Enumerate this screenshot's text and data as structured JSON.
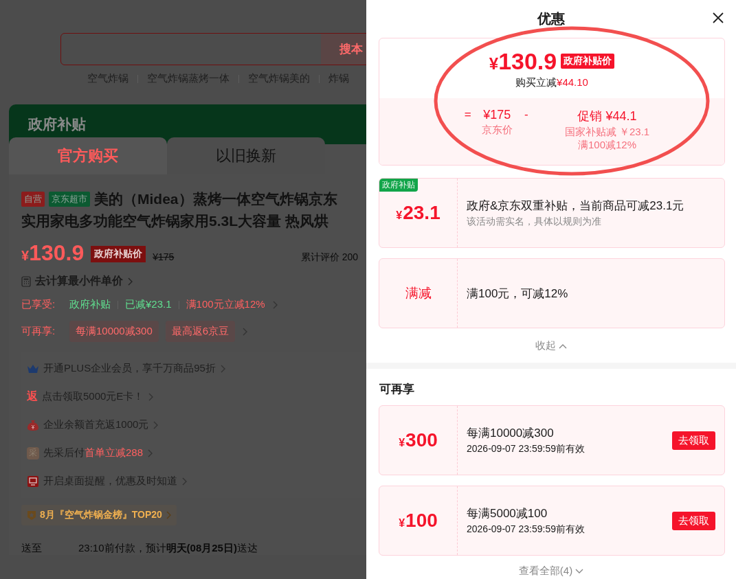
{
  "search": {
    "button": "搜本"
  },
  "suggestions": [
    "空气炸锅",
    "空气炸锅蒸烤一体",
    "空气炸锅美的",
    "炸锅"
  ],
  "subsidy_banner": {
    "title": "政府补贴"
  },
  "purchase_tabs": [
    {
      "label": "官方购买",
      "selected": true
    },
    {
      "label": "以旧换新",
      "selected": false
    }
  ],
  "product": {
    "badges": [
      {
        "label": "自营",
        "color": "#8c1c1c"
      },
      {
        "label": "京东超市",
        "color": "#0b5a31"
      }
    ],
    "title_lines": [
      "美的（Midea）蒸烤一体空气炸锅京东",
      "实用家电多功能空气炸锅家用5.3L大容量 热风烘"
    ],
    "price": {
      "currency": "¥",
      "amount": "130.9",
      "tag": "政府补贴价",
      "original": "¥175"
    },
    "reviews": "累计评价 200",
    "unit_price_link": "去计算最小件单价",
    "enjoyed": {
      "label": "已享受:",
      "items": [
        {
          "text": "政府补贴",
          "kind": "subsidy"
        },
        {
          "text": "已减¥23.1",
          "kind": "subsidy"
        },
        {
          "text": "满100元立减12%",
          "kind": "discount"
        }
      ]
    },
    "more": {
      "label": "可再享:",
      "chips": [
        "每满10000减300",
        "最高返6京豆"
      ]
    },
    "benefits": [
      {
        "kind": "crown",
        "text": "开通PLUS企业会员，享千万商品95折"
      },
      {
        "kind": "glyph",
        "glyph": "返",
        "text": "点击领取5000元E卡！"
      },
      {
        "kind": "money-bag",
        "text": "企业余额首充返1000元"
      },
      {
        "kind": "tile",
        "glyph": "采",
        "text": "先采后付",
        "highlight": "首单立减288"
      },
      {
        "kind": "monitor",
        "text": "开启桌面提醒，优惠及时知道"
      }
    ],
    "ranking": "8月『空气炸锅金榜』TOP20",
    "delivery": {
      "label": "送至",
      "text": "23:10前付款，预计**明天(08月25日)**送达"
    }
  },
  "drawer": {
    "title": "优惠",
    "summary": {
      "currency": "¥",
      "amount": "130.9",
      "tag": "政府补贴价",
      "saving_label": "购买立减",
      "saving": "¥44.10",
      "breakdown": {
        "equals": "=",
        "base": "¥175",
        "base_label": "京东价",
        "minus": "-",
        "promo_label": "促销",
        "promo": "¥44.1",
        "details": [
          "国家补贴减 ￥23.1",
          "满100减12%"
        ]
      }
    },
    "applied": [
      {
        "kind": "amount",
        "tag": "政府补贴",
        "currency": "¥",
        "amount": "23.1",
        "title": "政府&京东双重补贴，当前商品可减23.1元",
        "note": "该活动需实名，具体以规则为准"
      },
      {
        "kind": "label",
        "label": "满减",
        "title": "满100元，可减12%"
      }
    ],
    "collapse": "收起",
    "more_title": "可再享",
    "coupons": [
      {
        "currency": "¥",
        "amount": "300",
        "title": "每满10000减300",
        "validity": "2026-09-07 23:59:59前有效",
        "action": "去领取"
      },
      {
        "currency": "¥",
        "amount": "100",
        "title": "每满5000减100",
        "validity": "2026-09-07 23:59:59前有效",
        "action": "去领取"
      }
    ],
    "view_all": "查看全部(4)"
  }
}
